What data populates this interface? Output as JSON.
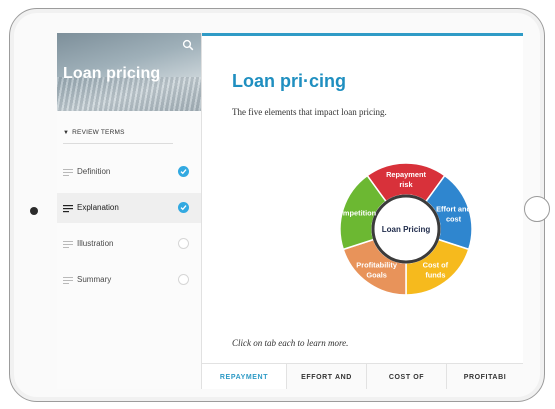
{
  "sidebar": {
    "title": "Loan pricing",
    "section_label": "REVIEW TERMS",
    "items": [
      {
        "label": "Definition",
        "status": "complete"
      },
      {
        "label": "Explanation",
        "status": "complete"
      },
      {
        "label": "Illustration",
        "status": "incomplete"
      },
      {
        "label": "Summary",
        "status": "incomplete"
      }
    ]
  },
  "main": {
    "title": "Loan pri·cing",
    "subtitle": "The five elements that impact loan pricing.",
    "hint": "Click on tab each to learn more.",
    "diagram": {
      "center_label": "Loan Pricing",
      "segments": [
        {
          "line1": "Repayment",
          "line2": "risk",
          "color": "#d8313a"
        },
        {
          "line1": "Effort and",
          "line2": "cost",
          "color": "#2f86cf"
        },
        {
          "line1": "Cost of",
          "line2": "funds",
          "color": "#f6ba1d"
        },
        {
          "line1": "Profitability",
          "line2": "Goals",
          "color": "#e8935a"
        },
        {
          "line1": "Competition",
          "line2": "",
          "color": "#6cb832"
        }
      ]
    },
    "tabs": [
      {
        "label": "REPAYMENT",
        "active": true
      },
      {
        "label": "EFFORT AND",
        "active": false
      },
      {
        "label": "COST OF",
        "active": false
      },
      {
        "label": "PROFITABI",
        "active": false
      }
    ]
  },
  "colors": {
    "accent": "#2f9bc6",
    "check": "#32a9e1"
  }
}
